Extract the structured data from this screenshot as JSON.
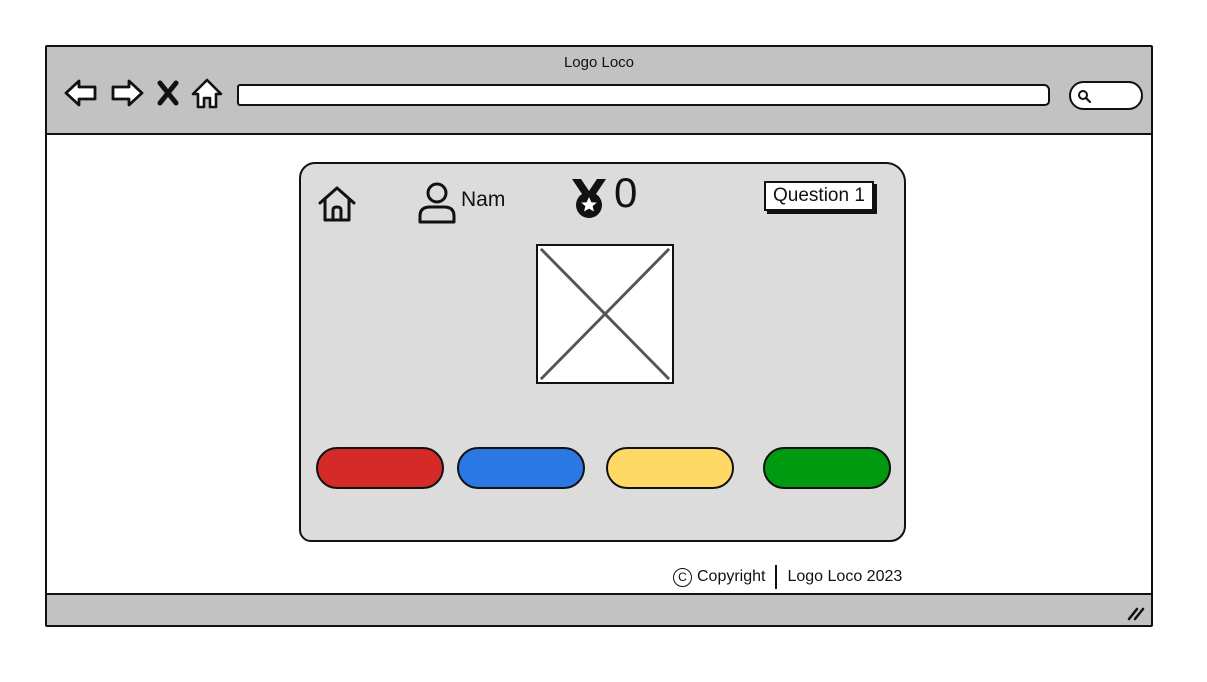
{
  "window": {
    "title": "Logo Loco"
  },
  "toolbar": {
    "back_icon": "arrow-left-icon",
    "forward_icon": "arrow-right-icon",
    "stop_icon": "close-icon",
    "home_icon": "home-icon",
    "address_value": "",
    "search_icon": "search-icon"
  },
  "game": {
    "home_icon": "home-icon",
    "user_icon": "user-icon",
    "user_name": "Nam",
    "medal_icon": "medal-icon",
    "score": "0",
    "question_label": "Question 1",
    "image_icon": "image-placeholder-icon",
    "answers": [
      {
        "color": "#d42a28"
      },
      {
        "color": "#2b78e4"
      },
      {
        "color": "#ffd966"
      },
      {
        "color": "#009a10"
      }
    ]
  },
  "footer": {
    "copyright_symbol": "C",
    "copyright_label": "Copyright",
    "company": "Logo Loco 2023"
  },
  "colors": {
    "chrome": "#c2c2c2",
    "card": "#dcdcdc",
    "stroke": "#111111"
  }
}
